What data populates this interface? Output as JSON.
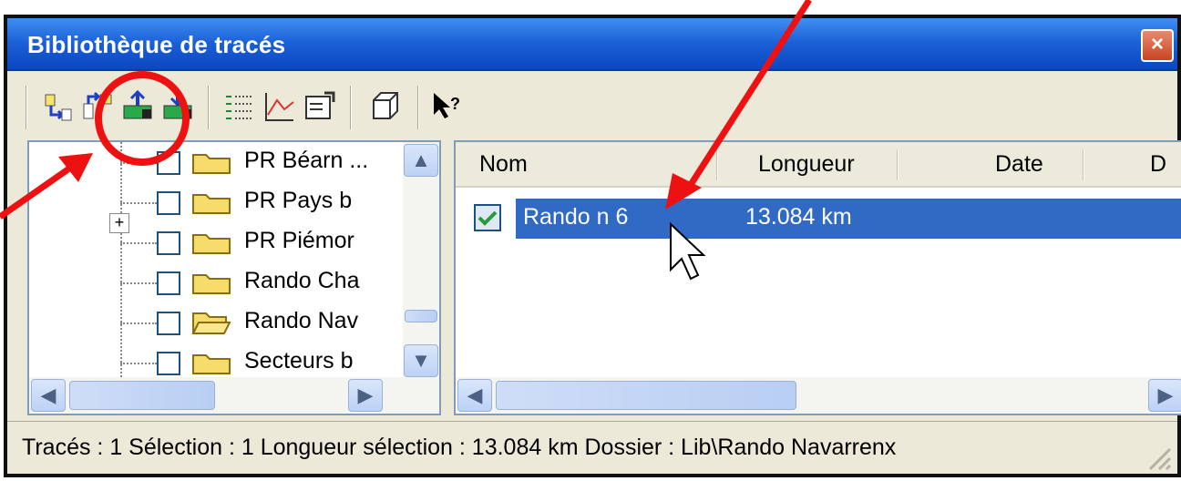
{
  "window": {
    "title": "Bibliothèque de tracés",
    "close_label": "×"
  },
  "toolbar": {
    "buttons": [
      {
        "name": "import-trace-icon",
        "tooltip": ""
      },
      {
        "name": "export-trace-icon",
        "tooltip": ""
      },
      {
        "name": "upload-gps-icon",
        "tooltip": ""
      },
      {
        "name": "download-gps-icon",
        "tooltip": ""
      },
      {
        "name": "list-view-icon",
        "tooltip": ""
      },
      {
        "name": "profile-chart-icon",
        "tooltip": ""
      },
      {
        "name": "properties-icon",
        "tooltip": ""
      },
      {
        "name": "3d-box-icon",
        "tooltip": ""
      },
      {
        "name": "help-cursor-icon",
        "tooltip": ""
      }
    ]
  },
  "tree": {
    "items": [
      {
        "label": "PR Béarn ..."
      },
      {
        "label": "PR Pays b"
      },
      {
        "label": "PR Piémor"
      },
      {
        "label": "Rando Cha"
      },
      {
        "label": "Rando Nav"
      },
      {
        "label": "Secteurs b"
      }
    ],
    "expand_symbol": "+"
  },
  "list": {
    "columns": [
      "Nom",
      "Longueur",
      "Date",
      "D"
    ],
    "rows": [
      {
        "name": "Rando n 6",
        "length": "13.084 km",
        "checked": true
      }
    ]
  },
  "statusbar": {
    "text": "Tracés : 1 Sélection : 1 Longueur sélection : 13.084 km Dossier : Lib\\Rando Navarrenx"
  },
  "colors": {
    "titlebar": "#1a5fd6",
    "selection": "#316ac5",
    "annotation": "#ee1111"
  }
}
